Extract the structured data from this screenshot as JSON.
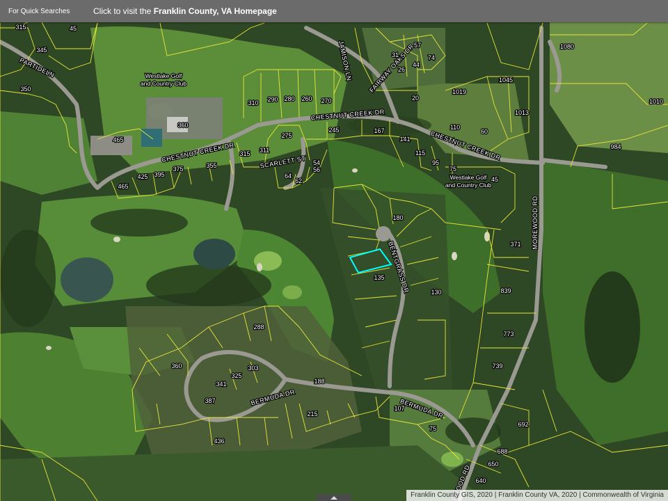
{
  "header": {
    "quick_searches_label": "For Quick Searches",
    "homepage_prefix": "Click to visit the ",
    "homepage_link": "Franklin County, VA Homepage"
  },
  "attribution": "Franklin County GIS, 2020 | Franklin County VA, 2020 | Commonwealth of Virginia",
  "colors": {
    "parcel_lines": "#e6e63a",
    "selected_parcel": "#00ffff",
    "header_bg": "#6b6b6b"
  },
  "place_labels": {
    "westlake_club_1": [
      "Westlake Golf",
      "and Country Club"
    ],
    "westlake_club_2": [
      "Westlake Golf",
      "and Country Club"
    ]
  },
  "roads": {
    "partridge": "PARTIDELN",
    "jamison": "JAMISON LN",
    "fairway_oaks": "FAIRWAY OAKS DR",
    "chestnut_1": "CHESTNUT CREEK DR",
    "chestnut_2": "CHESTNUT CREEK DR",
    "chestnut_3": "CHESTNUT CREEK DR",
    "scarlett": "SCARLETT ST",
    "morewood_1": "MOREWOOD RD",
    "morewood_2": "EWOOD RD",
    "bentgrass": "BENTGRASS DR",
    "bermuda_1": "BERMUDA DR",
    "bermuda_2": "BERMUDA DR"
  },
  "parcels": [
    {
      "id": "p315a",
      "label": "315"
    },
    {
      "id": "p45a",
      "label": "45"
    },
    {
      "id": "p345",
      "label": "345"
    },
    {
      "id": "p350",
      "label": "350"
    },
    {
      "id": "p31",
      "label": "31"
    },
    {
      "id": "p57",
      "label": "57"
    },
    {
      "id": "p26",
      "label": "26"
    },
    {
      "id": "p44",
      "label": "44"
    },
    {
      "id": "p74",
      "label": "74"
    },
    {
      "id": "p1080",
      "label": "1080"
    },
    {
      "id": "p1045",
      "label": "1045"
    },
    {
      "id": "p1019",
      "label": "1019"
    },
    {
      "id": "p1010",
      "label": "1010"
    },
    {
      "id": "p1013",
      "label": "1013"
    },
    {
      "id": "p310",
      "label": "310"
    },
    {
      "id": "p290",
      "label": "290"
    },
    {
      "id": "p280",
      "label": "280"
    },
    {
      "id": "p260",
      "label": "260"
    },
    {
      "id": "p270",
      "label": "270"
    },
    {
      "id": "p20",
      "label": "20"
    },
    {
      "id": "p360",
      "label": "360"
    },
    {
      "id": "p110",
      "label": "110"
    },
    {
      "id": "p60",
      "label": "60"
    },
    {
      "id": "p984",
      "label": "984"
    },
    {
      "id": "p465a",
      "label": "465"
    },
    {
      "id": "p275",
      "label": "275"
    },
    {
      "id": "p245",
      "label": "245"
    },
    {
      "id": "p167",
      "label": "167"
    },
    {
      "id": "p141",
      "label": "141"
    },
    {
      "id": "p115",
      "label": "115"
    },
    {
      "id": "p95",
      "label": "95"
    },
    {
      "id": "p75a",
      "label": "75"
    },
    {
      "id": "p45b",
      "label": "45"
    },
    {
      "id": "p315b",
      "label": "315"
    },
    {
      "id": "p311",
      "label": "311"
    },
    {
      "id": "p54",
      "label": "54"
    },
    {
      "id": "p56",
      "label": "56"
    },
    {
      "id": "p64",
      "label": "64"
    },
    {
      "id": "p62",
      "label": "62"
    },
    {
      "id": "p465b",
      "label": "465"
    },
    {
      "id": "p425",
      "label": "425"
    },
    {
      "id": "p395",
      "label": "395"
    },
    {
      "id": "p375",
      "label": "375"
    },
    {
      "id": "p355",
      "label": "355"
    },
    {
      "id": "p180",
      "label": "180"
    },
    {
      "id": "p371",
      "label": "371"
    },
    {
      "id": "p135",
      "label": "135"
    },
    {
      "id": "p130",
      "label": "130"
    },
    {
      "id": "p839",
      "label": "839"
    },
    {
      "id": "p773",
      "label": "773"
    },
    {
      "id": "p739",
      "label": "739"
    },
    {
      "id": "p288",
      "label": "288"
    },
    {
      "id": "p360b",
      "label": "360"
    },
    {
      "id": "p325",
      "label": "325"
    },
    {
      "id": "p303",
      "label": "303"
    },
    {
      "id": "p341",
      "label": "341"
    },
    {
      "id": "p387",
      "label": "387"
    },
    {
      "id": "p188",
      "label": "188"
    },
    {
      "id": "p215",
      "label": "215"
    },
    {
      "id": "p107",
      "label": "107"
    },
    {
      "id": "p75b",
      "label": "75"
    },
    {
      "id": "p436",
      "label": "436"
    },
    {
      "id": "p692",
      "label": "692"
    },
    {
      "id": "p688",
      "label": "688"
    },
    {
      "id": "p650",
      "label": "650"
    },
    {
      "id": "p640",
      "label": "640"
    }
  ]
}
